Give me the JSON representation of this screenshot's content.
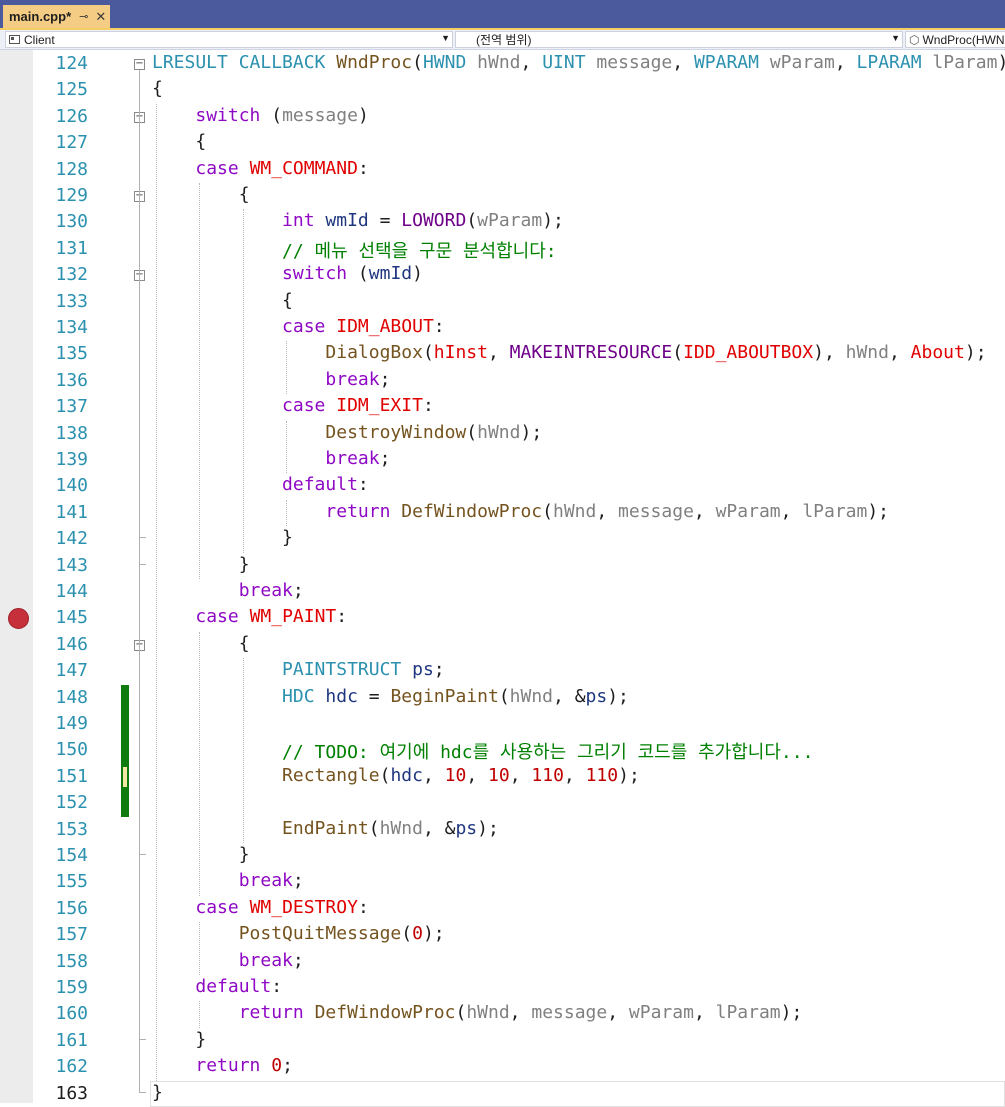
{
  "tab": {
    "title": "main.cpp*",
    "pin_icon": "pin-icon",
    "close_icon": "close-icon"
  },
  "navbar": {
    "project": "Client",
    "scope": "(전역 범위)",
    "member": "WndProc(HWN"
  },
  "editor": {
    "breakpoint_line": 145,
    "current_line": 163,
    "lines": [
      {
        "n": "124",
        "t": "LRESULT CALLBACK WndProc(HWND hWnd, UINT message, WPARAM wParam, LPARAM lParam)"
      },
      {
        "n": "125",
        "t": "{"
      },
      {
        "n": "126",
        "t": "    switch (message)"
      },
      {
        "n": "127",
        "t": "    {"
      },
      {
        "n": "128",
        "t": "    case WM_COMMAND:"
      },
      {
        "n": "129",
        "t": "        {"
      },
      {
        "n": "130",
        "t": "            int wmId = LOWORD(wParam);"
      },
      {
        "n": "131",
        "t": "            // 메뉴 선택을 구문 분석합니다:"
      },
      {
        "n": "132",
        "t": "            switch (wmId)"
      },
      {
        "n": "133",
        "t": "            {"
      },
      {
        "n": "134",
        "t": "            case IDM_ABOUT:"
      },
      {
        "n": "135",
        "t": "                DialogBox(hInst, MAKEINTRESOURCE(IDD_ABOUTBOX), hWnd, About);"
      },
      {
        "n": "136",
        "t": "                break;"
      },
      {
        "n": "137",
        "t": "            case IDM_EXIT:"
      },
      {
        "n": "138",
        "t": "                DestroyWindow(hWnd);"
      },
      {
        "n": "139",
        "t": "                break;"
      },
      {
        "n": "140",
        "t": "            default:"
      },
      {
        "n": "141",
        "t": "                return DefWindowProc(hWnd, message, wParam, lParam);"
      },
      {
        "n": "142",
        "t": "            }"
      },
      {
        "n": "143",
        "t": "        }"
      },
      {
        "n": "144",
        "t": "        break;"
      },
      {
        "n": "145",
        "t": "    case WM_PAINT:"
      },
      {
        "n": "146",
        "t": "        {"
      },
      {
        "n": "147",
        "t": "            PAINTSTRUCT ps;"
      },
      {
        "n": "148",
        "t": "            HDC hdc = BeginPaint(hWnd, &ps);"
      },
      {
        "n": "149",
        "t": ""
      },
      {
        "n": "150",
        "t": "            // TODO: 여기에 hdc를 사용하는 그리기 코드를 추가합니다..."
      },
      {
        "n": "151",
        "t": "            Rectangle(hdc, 10, 10, 110, 110);"
      },
      {
        "n": "152",
        "t": ""
      },
      {
        "n": "153",
        "t": "            EndPaint(hWnd, &ps);"
      },
      {
        "n": "154",
        "t": "        }"
      },
      {
        "n": "155",
        "t": "        break;"
      },
      {
        "n": "156",
        "t": "    case WM_DESTROY:"
      },
      {
        "n": "157",
        "t": "        PostQuitMessage(0);"
      },
      {
        "n": "158",
        "t": "        break;"
      },
      {
        "n": "159",
        "t": "    default:"
      },
      {
        "n": "160",
        "t": "        return DefWindowProc(hWnd, message, wParam, lParam);"
      },
      {
        "n": "161",
        "t": "    }"
      },
      {
        "n": "162",
        "t": "    return 0;"
      },
      {
        "n": "163",
        "t": "}"
      }
    ]
  },
  "colors": {
    "keyword": "#8f08c4",
    "type": "#2b91af",
    "enum": "#e00000",
    "comment": "#008000",
    "number": "#c00000",
    "tab_active": "#f5cc84",
    "change_bar": "#107c10",
    "breakpoint": "#c6303a"
  }
}
